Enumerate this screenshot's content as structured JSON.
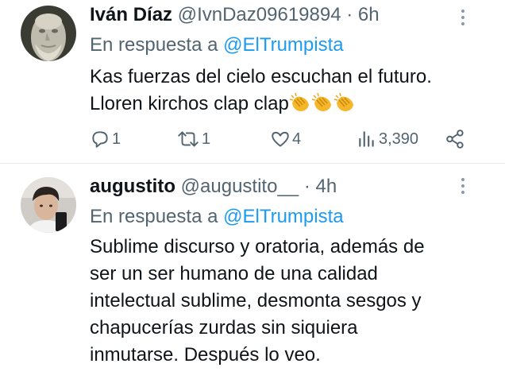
{
  "tweets": [
    {
      "name": "Iván Díaz",
      "handle": "@IvnDaz09619894",
      "separator": "·",
      "time": "6h",
      "reply_prefix": "En respuesta a",
      "reply_to": "@ElTrumpista",
      "text_lines": [
        "Kas fuerzas del cielo escuchan el futuro.",
        "Lloren kirchos clap clap"
      ],
      "emoji": "clapping-hands x3",
      "actions": {
        "replies": "1",
        "retweets": "1",
        "likes": "4",
        "views": "3,390"
      },
      "avatar_icon": "statue-bust-avatar"
    },
    {
      "name": "augustito",
      "handle": "@augustito__",
      "separator": "·",
      "time": "4h",
      "reply_prefix": "En respuesta a",
      "reply_to": "@ElTrumpista",
      "text_lines": [
        "Sublime discurso y oratoria, además de",
        "ser un ser humano de una calidad",
        "intelectual sublime, desmonta sesgos y",
        "chapucerías zurdas sin siquiera",
        "inmutarse. Después lo veo."
      ],
      "avatar_icon": "person-selfie-avatar"
    }
  ],
  "colors": {
    "primary_text": "#0f1419",
    "secondary_text": "#536471",
    "mention": "#1d9bf0",
    "divider": "#e6e9ec"
  }
}
